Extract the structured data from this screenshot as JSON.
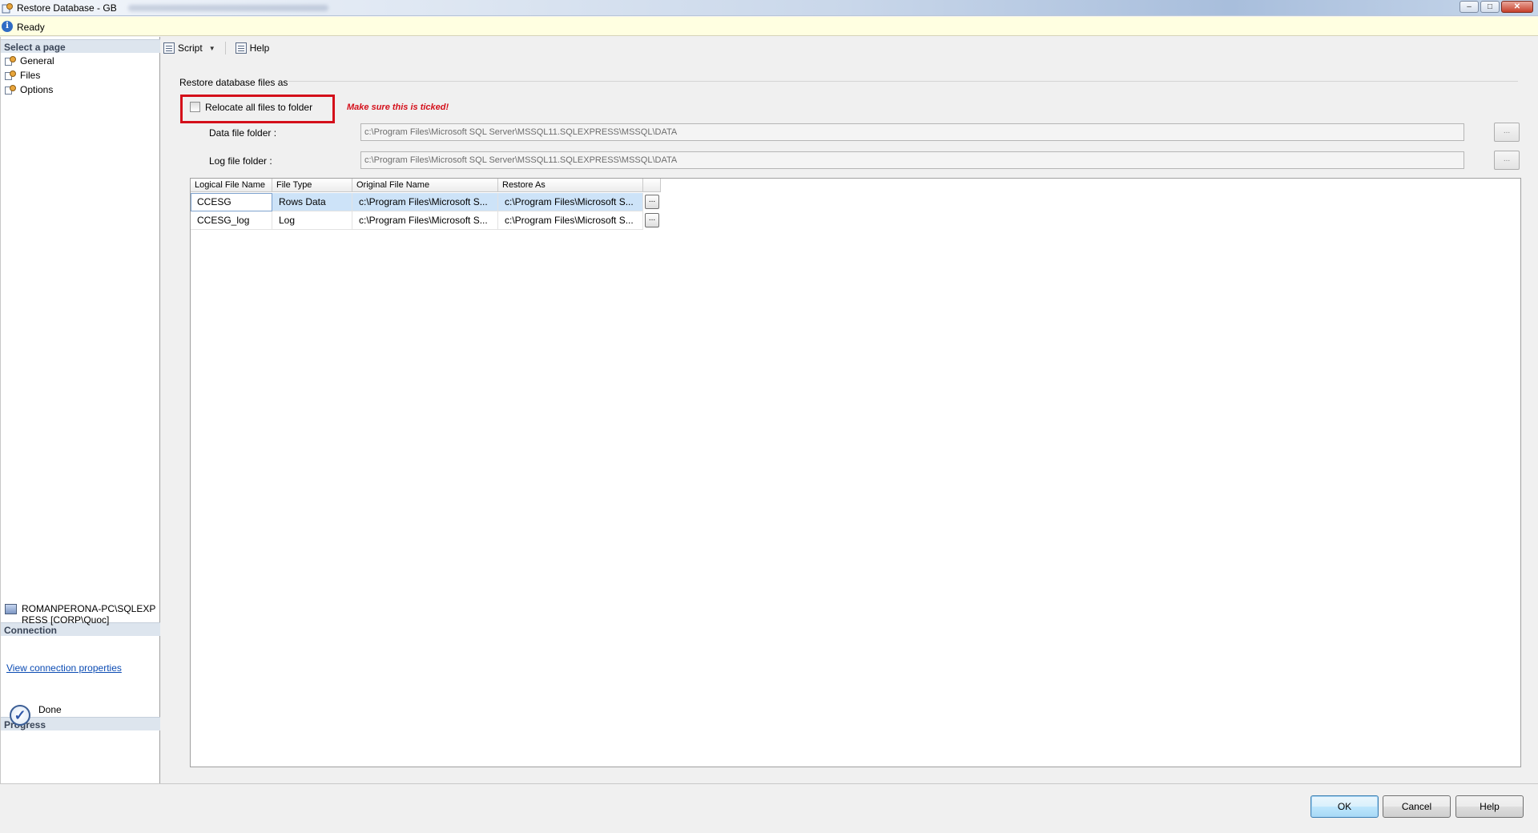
{
  "window": {
    "title": "Restore Database - GB",
    "controls": {
      "minimize": "–",
      "maximize": "□",
      "close": "✕"
    }
  },
  "status": {
    "text": "Ready",
    "icon": "info-icon"
  },
  "left_pane": {
    "select_page_header": "Select a page",
    "pages": [
      {
        "label": "General",
        "icon": "page-wrench-icon"
      },
      {
        "label": "Files",
        "icon": "page-wrench-icon"
      },
      {
        "label": "Options",
        "icon": "page-wrench-icon"
      }
    ],
    "connection_header": "Connection",
    "connection_text": "ROMANPERONA-PC\\SQLEXPRESS [CORP\\Quoc]",
    "connection_link": "View connection properties",
    "progress_header": "Progress",
    "progress_text": "Done"
  },
  "toolbar": {
    "script_label": "Script",
    "help_label": "Help"
  },
  "restore_files": {
    "group_label": "Restore database files as",
    "relocate_label": "Relocate all files to folder",
    "relocate_checked": false,
    "note": "Make sure this is ticked!",
    "data_folder_label": "Data file folder :",
    "data_folder_value": "c:\\Program Files\\Microsoft SQL Server\\MSSQL11.SQLEXPRESS\\MSSQL\\DATA",
    "log_folder_label": "Log file folder :",
    "log_folder_value": "c:\\Program Files\\Microsoft SQL Server\\MSSQL11.SQLEXPRESS\\MSSQL\\DATA",
    "browse_label": "...",
    "accent_color": "#d40f1a"
  },
  "grid": {
    "columns": [
      "Logical File Name",
      "File Type",
      "Original File Name",
      "Restore As"
    ],
    "rows": [
      {
        "logical": "CCESG",
        "type": "Rows Data",
        "original": "c:\\Program Files\\Microsoft S...",
        "restore_as": "c:\\Program Files\\Microsoft S...",
        "button": "..."
      },
      {
        "logical": "CCESG_log",
        "type": "Log",
        "original": "c:\\Program Files\\Microsoft S...",
        "restore_as": "c:\\Program Files\\Microsoft S...",
        "button": "..."
      }
    ]
  },
  "buttons": {
    "ok": "OK",
    "cancel": "Cancel",
    "help": "Help"
  }
}
